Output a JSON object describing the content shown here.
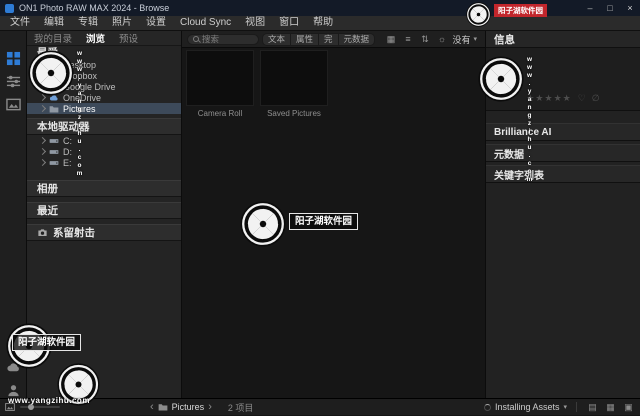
{
  "titlebar": {
    "app_title": "ON1 Photo RAW MAX 2024 - Browse"
  },
  "menubar": {
    "items": [
      "文件",
      "编辑",
      "专辑",
      "照片",
      "设置",
      "Cloud Sync",
      "视图",
      "窗口",
      "帮助"
    ]
  },
  "left_panel": {
    "tabs": [
      {
        "label": "我的目录"
      },
      {
        "label": "浏览"
      },
      {
        "label": "预设"
      }
    ],
    "favorites": {
      "title": "最爱",
      "items": [
        {
          "label": "Desktop"
        },
        {
          "label": "Dropbox"
        },
        {
          "label": "Google Drive"
        },
        {
          "label": "OneDrive"
        },
        {
          "label": "Pictures"
        }
      ]
    },
    "local_drives": {
      "title": "本地驱动器",
      "items": [
        {
          "label": "C:"
        },
        {
          "label": "D:"
        },
        {
          "label": "E:"
        }
      ]
    },
    "albums_title": "相册",
    "recent_title": "最近",
    "tethered_title": "系留射击"
  },
  "toolbar": {
    "search_placeholder": "搜索",
    "filters": [
      "文本",
      "属性",
      "完",
      "元数据"
    ],
    "sort_value": "没有"
  },
  "content": {
    "folders": [
      {
        "name": "Camera Roll"
      },
      {
        "name": "Saved Pictures"
      }
    ]
  },
  "info_panel": {
    "title": "信息",
    "sections": [
      "Brilliance AI",
      "元数据",
      "关键字列表"
    ]
  },
  "statusbar": {
    "location": "Pictures",
    "count": "2 项目",
    "installing": "Installing Assets"
  },
  "watermark": {
    "site_name": "阳子湖软件园",
    "site_url": "www.yangzihu.com"
  },
  "icons": {
    "minimize": "–",
    "maximize": "□",
    "close": "×",
    "grid_view": "▦",
    "list_view": "≡",
    "sort": "⇅",
    "preview_light": "☼",
    "caret_down": "▾",
    "nav_prev": "‹",
    "nav_next": "›",
    "film_view": "▤",
    "detail_view": "▣",
    "stars": "★★★★★",
    "like": "♡",
    "reject": "∅"
  }
}
